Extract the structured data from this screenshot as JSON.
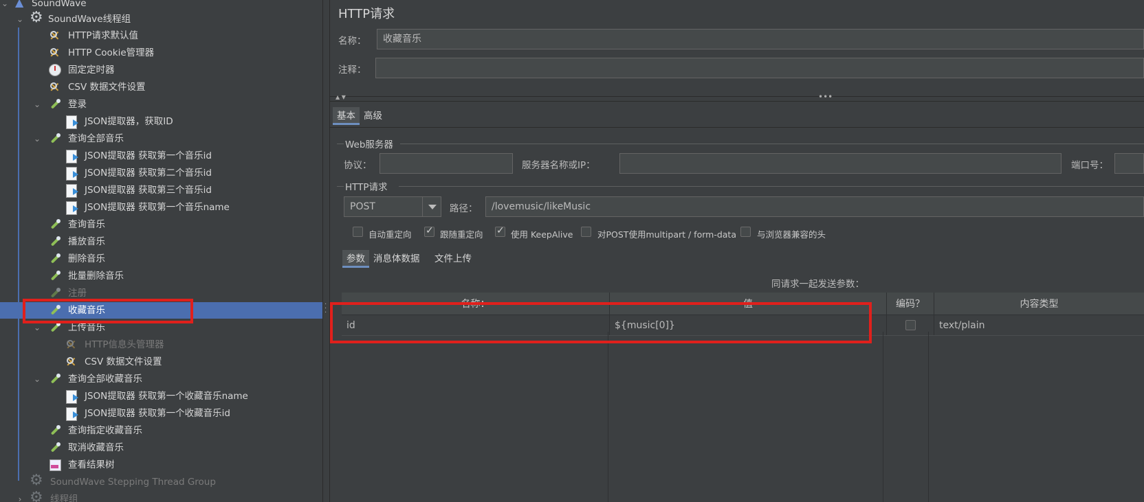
{
  "tree": {
    "nodes": [
      {
        "label": "SoundWave",
        "icon": "flask-icon"
      },
      {
        "label": "SoundWave线程组",
        "icon": "gear-icon"
      },
      {
        "label": "HTTP请求默认值",
        "icon": "tools-icon"
      },
      {
        "label": "HTTP Cookie管理器",
        "icon": "tools-icon"
      },
      {
        "label": "固定定时器",
        "icon": "timer-icon"
      },
      {
        "label": "CSV 数据文件设置",
        "icon": "tools-icon"
      },
      {
        "label": "登录",
        "icon": "pipette-icon"
      },
      {
        "label": "JSON提取器，获取ID",
        "icon": "doc-icon"
      },
      {
        "label": "查询全部音乐",
        "icon": "pipette-icon"
      },
      {
        "label": "JSON提取器 获取第一个音乐id",
        "icon": "doc-icon"
      },
      {
        "label": "JSON提取器 获取第二个音乐id",
        "icon": "doc-icon"
      },
      {
        "label": "JSON提取器 获取第三个音乐id",
        "icon": "doc-icon"
      },
      {
        "label": "JSON提取器 获取第一个音乐name",
        "icon": "doc-icon"
      },
      {
        "label": "查询音乐",
        "icon": "pipette-icon"
      },
      {
        "label": "播放音乐",
        "icon": "pipette-icon"
      },
      {
        "label": "删除音乐",
        "icon": "pipette-icon"
      },
      {
        "label": "批量删除音乐",
        "icon": "pipette-icon"
      },
      {
        "label": "注册",
        "icon": "pipette-icon"
      },
      {
        "label": "收藏音乐",
        "icon": "pipette-icon"
      },
      {
        "label": "上传音乐",
        "icon": "pipette-icon"
      },
      {
        "label": "HTTP信息头管理器",
        "icon": "tools-icon"
      },
      {
        "label": "CSV 数据文件设置",
        "icon": "tools-icon"
      },
      {
        "label": "查询全部收藏音乐",
        "icon": "pipette-icon"
      },
      {
        "label": "JSON提取器 获取第一个收藏音乐name",
        "icon": "doc-icon"
      },
      {
        "label": "JSON提取器 获取第一个收藏音乐id",
        "icon": "doc-icon"
      },
      {
        "label": "查询指定收藏音乐",
        "icon": "pipette-icon"
      },
      {
        "label": "取消收藏音乐",
        "icon": "pipette-icon"
      },
      {
        "label": "查看结果树",
        "icon": "chart-icon"
      },
      {
        "label": "SoundWave Stepping Thread Group",
        "icon": "gear-icon"
      },
      {
        "label": "线程组",
        "icon": "gear-icon"
      }
    ],
    "selected_label": "收藏音乐"
  },
  "panel": {
    "title": "HTTP请求",
    "name_label": "名称：",
    "name_value": "收藏音乐",
    "comment_label": "注释：",
    "comment_value": "",
    "tabs": [
      "基本",
      "高级"
    ],
    "web_server": {
      "group_title": "Web服务器",
      "protocol_label": "协议：",
      "protocol_value": "",
      "server_label": "服务器名称或IP：",
      "server_value": "",
      "port_label": "端口号：",
      "port_value": ""
    },
    "http_request": {
      "group_title": "HTTP请求",
      "method": "POST",
      "path_label": "路径：",
      "path_value": "/lovemusic/likeMusic",
      "options": [
        {
          "label": "自动重定向",
          "checked": false
        },
        {
          "label": "跟随重定向",
          "checked": true
        },
        {
          "label": "使用 KeepAlive",
          "checked": true
        },
        {
          "label": "对POST使用multipart / form-data",
          "checked": false
        },
        {
          "label": "与浏览器兼容的头",
          "checked": false
        }
      ]
    },
    "sub_tabs": [
      "参数",
      "消息体数据",
      "文件上传"
    ],
    "params_caption": "同请求一起发送参数：",
    "params": {
      "columns": [
        "名称：",
        "值",
        "编码？",
        "内容类型"
      ],
      "rows": [
        {
          "name": "id",
          "value": "${music[0]}",
          "encode": false,
          "content_type": "text/plain"
        }
      ]
    }
  },
  "colors": {
    "background": "#3c3f41",
    "selection": "#4b6eaf",
    "highlight": "#e0201c"
  }
}
